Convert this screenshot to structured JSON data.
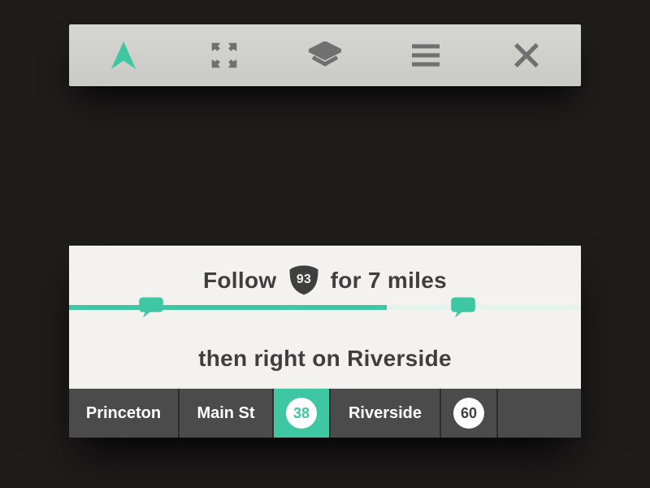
{
  "toolbar": {
    "icons": {
      "nav": "navigation-arrow-icon",
      "expand": "expand-icon",
      "layers": "layers-icon",
      "menu": "menu-icon",
      "close": "close-icon"
    }
  },
  "colors": {
    "accent": "#3fc7a4",
    "toolbar_icon": "#707070",
    "card_bg": "#f3f2ef",
    "strip_bg": "#4b4b4b",
    "text": "#3f3f3f"
  },
  "instruction": {
    "line1_prefix": "Follow",
    "highway_shield": "93",
    "line1_suffix": "for 7 miles",
    "line2": "then right on Riverside",
    "progress_percent": 62,
    "bubbles": [
      {
        "position_percent": 16
      },
      {
        "position_percent": 77
      }
    ]
  },
  "route_strip": [
    {
      "type": "text",
      "label": "Princeton",
      "active": false
    },
    {
      "type": "text",
      "label": "Main St",
      "active": false
    },
    {
      "type": "badge",
      "label": "38",
      "active": true
    },
    {
      "type": "text",
      "label": "Riverside",
      "active": false
    },
    {
      "type": "badge",
      "label": "60",
      "active": false
    },
    {
      "type": "spacer"
    }
  ]
}
